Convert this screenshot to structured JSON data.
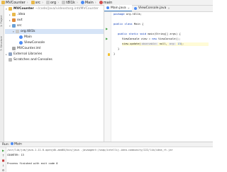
{
  "breadcrumb": {
    "items": [
      {
        "label": "MVCounter",
        "icon": "folder-icon"
      },
      {
        "label": "src",
        "icon": "folder-icon"
      },
      {
        "label": "org",
        "icon": "package-icon"
      },
      {
        "label": "t8l1k",
        "icon": "package-icon"
      },
      {
        "label": "Main",
        "icon": "class-icon"
      },
      {
        "label": "main",
        "icon": "method-icon"
      }
    ]
  },
  "tool_stripe": {
    "project_label": "1: Project",
    "structure_label": "7: Structure"
  },
  "project_tree": {
    "rows": [
      {
        "label": "MVCounter",
        "path": "~/code/java/videostorg.intl/MVCounter",
        "icon": "folder-icon",
        "expanded": true
      },
      {
        "label": ".idea",
        "icon": "folder-icon",
        "expanded": false
      },
      {
        "label": "out",
        "icon": "excluded-folder-icon",
        "expanded": false
      },
      {
        "label": "src",
        "icon": "source-folder-icon",
        "expanded": true
      },
      {
        "label": "org.t8l1k",
        "icon": "package-icon",
        "expanded": true,
        "selected": true
      },
      {
        "label": "Main",
        "icon": "class-icon"
      },
      {
        "label": "ViewConsole",
        "icon": "class-icon"
      },
      {
        "label": "MVCounter.iml",
        "icon": "iml-file-icon"
      },
      {
        "label": "External Libraries",
        "icon": "library-icon",
        "expanded": false
      },
      {
        "label": "Scratches and Consoles",
        "icon": "scratch-icon"
      }
    ]
  },
  "editor": {
    "tabs": [
      {
        "label": "Main.java",
        "active": true
      },
      {
        "label": "ViewConsole.java",
        "active": false
      }
    ],
    "code": {
      "line1": {
        "kw": "package",
        "rest": " org.t8l1k;"
      },
      "line2": {
        "kw": "public class",
        "rest": " Main {"
      },
      "line3": {
        "kw": "public static void",
        "rest": " main(String[] args) {"
      },
      "line4": {
        "cls": "ViewConsole",
        "rest": " view = ",
        "kw": "new",
        "rest2": " ViewConsole();"
      },
      "line5": {
        "pre": "view.update(",
        "hint1": "observable:",
        "mid": " null, ",
        "hint2": "arg:",
        "num": " 13",
        "post": ");"
      },
      "line6": {
        "text": "}"
      },
      "line7": {
        "text": "}"
      }
    }
  },
  "run_panel": {
    "label": "Run:",
    "tab_label": "Main",
    "console": {
      "command": "/usr/lib/jvm/java-1.11.0-openjdk-amd64/bin/java -javaagent:/snap/intellij-idea-community/222/lib/idea_rt.jar",
      "output": "COUNTER: 13",
      "exit": "Process finished with exit code 0"
    }
  },
  "colors": {
    "keyword": "#0033b3",
    "number": "#1750eb",
    "selection": "#d6e4f7",
    "run_green": "#3fa23f"
  }
}
